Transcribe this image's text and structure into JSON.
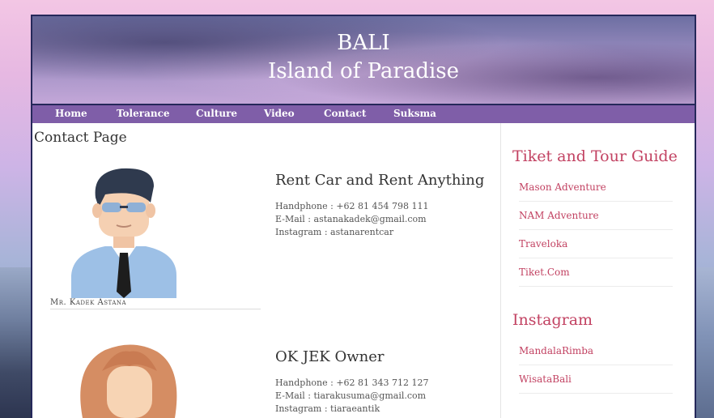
{
  "banner": {
    "title": "BALI",
    "subtitle": "Island of Paradise"
  },
  "nav": [
    "Home",
    "Tolerance",
    "Culture",
    "Video",
    "Contact",
    "Suksma"
  ],
  "page_title": "Contact Page",
  "contacts": [
    {
      "caption": "Mr. Kadek Astana",
      "heading": "Rent Car and Rent Anything",
      "lines": [
        "Handphone : +62 81 454 798 111",
        "E-Mail : astanakadek@gmail.com",
        "Instagram : astanarentcar"
      ]
    },
    {
      "caption": "",
      "heading": "OK JEK Owner",
      "lines": [
        "Handphone : +62 81 343 712 127",
        "E-Mail : tiarakusuma@gmail.com",
        "Instagram : tiaraeantik"
      ]
    }
  ],
  "sidebar": {
    "tour_heading": "Tiket and Tour Guide",
    "tour_links": [
      "Mason Adventure",
      "NAM Adventure",
      "Traveloka",
      "Tiket.Com"
    ],
    "instagram_heading": "Instagram",
    "instagram_links": [
      "MandalaRimba",
      "WisataBali"
    ]
  },
  "colors": {
    "accent": "#c24262",
    "nav_bg": "#7f5ea8",
    "frame": "#25285a"
  }
}
